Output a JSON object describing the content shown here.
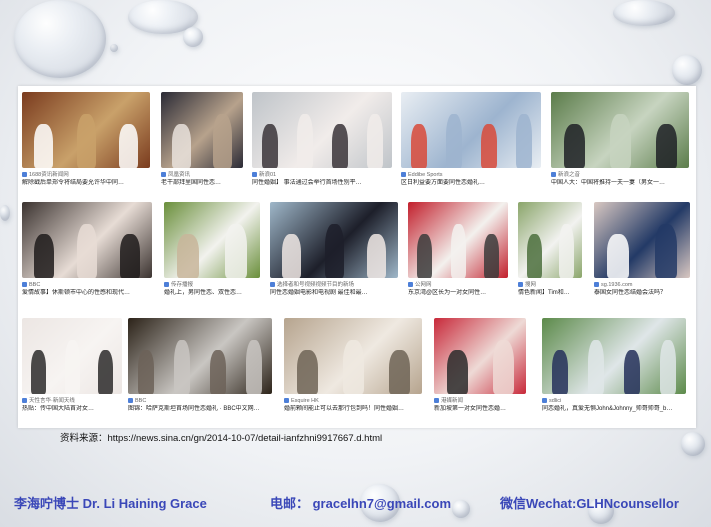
{
  "rows": [
    {
      "tiles": [
        {
          "source": "1688资讯新闻网",
          "title": "解除戳后单郑令将结局要允许华中同…",
          "palette": [
            "#7a3b1e",
            "#c9a16a",
            "#ffffff"
          ]
        },
        {
          "source": "凤凰资讯",
          "title": "老干部拜里国同性恋…",
          "palette": [
            "#2a2a35",
            "#b7a28c",
            "#e9e2dc"
          ]
        },
        {
          "source": "新浪01",
          "title": "同性婚姻】 事法通过会举行首场性别平…",
          "palette": [
            "#bfc4c9",
            "#f1ecea",
            "#3a3438"
          ]
        },
        {
          "source": "Eddibe Sports",
          "title": "区日利益要方面要同性恋婚礼…",
          "palette": [
            "#e9eef3",
            "#9db4cf",
            "#d84a3a"
          ]
        },
        {
          "source": "新浪之音",
          "title": "中国人大：中国将推持一夫一妻（男女一…",
          "palette": [
            "#5b7c4a",
            "#c7d4c0",
            "#1f2126"
          ]
        }
      ]
    },
    {
      "tiles": [
        {
          "source": "BBC",
          "title": "爱情故事】休斯顿市中心的性感和现代…",
          "palette": [
            "#3b3330",
            "#e7dcd5",
            "#1e1b1b"
          ]
        },
        {
          "source": "传存播报",
          "title": "婚礼上，男同性恋、双性恋…",
          "palette": [
            "#6a8f3b",
            "#f2f2ee",
            "#c8b59a"
          ]
        },
        {
          "source": "选择者和号视频视频节目的新场",
          "title": "同性恋婚姻电影和电视剧 最佳和最…",
          "palette": [
            "#9fb7c9",
            "#1d1f2a",
            "#f0e8e4"
          ]
        },
        {
          "source": "公网网",
          "title": "东京湾@区长为一对女同性…",
          "palette": [
            "#c21f2c",
            "#f3f1ee",
            "#3b3b3b"
          ]
        },
        {
          "source": "搜网",
          "title": "情色新闻】Tim和…",
          "palette": [
            "#8aa56a",
            "#f2f2f0",
            "#4b6e3c"
          ]
        },
        {
          "source": "sg.1936.com",
          "title": "泰国女同性恋结婚会法吗？",
          "palette": [
            "#d9c8c2",
            "#233a66",
            "#ffffff"
          ]
        }
      ]
    },
    {
      "tiles": [
        {
          "source": "天性言华·新闻天线",
          "title": "热贴：传中国大陆首对女…",
          "palette": [
            "#ece6e3",
            "#f7f4f2",
            "#2c2a2a"
          ]
        },
        {
          "source": "BBC",
          "title": "图锦：哈萨克斯坦首场同性恋婚礼 · BBC中文网…",
          "palette": [
            "#2c2319",
            "#c9c6c2",
            "#6c6158"
          ]
        },
        {
          "source": "Esquire HK",
          "title": "婚前颗间能止可以去那行包到吗！同性婚姻…",
          "palette": [
            "#b6a48e",
            "#efe9e1",
            "#6f6456"
          ]
        },
        {
          "source": "港媒新闻",
          "title": "新加坡第一对女同性恋婚…",
          "palette": [
            "#c8293a",
            "#eedad6",
            "#2a2a2a"
          ]
        },
        {
          "source": "sdlici",
          "title": "同恋婚礼，真爱无惧John&Johnny_帅哥帅哥_b…",
          "palette": [
            "#5c8a4a",
            "#dfe6e8",
            "#24305a"
          ]
        }
      ]
    }
  ],
  "source_line": "资料来源：https://news.sina.cn/gn/2014-10-07/detail-ianfzhni9917667.d.html",
  "footer": {
    "author": "李海咛博士  Dr. Li Haining Grace",
    "email": "电邮： gracelhn7@gmail.com",
    "wechat": "微信Wechat:GLHNcounsellor"
  },
  "colors": {
    "footer_text": "#3a47b8",
    "source_icon": "#4d7fd8"
  }
}
